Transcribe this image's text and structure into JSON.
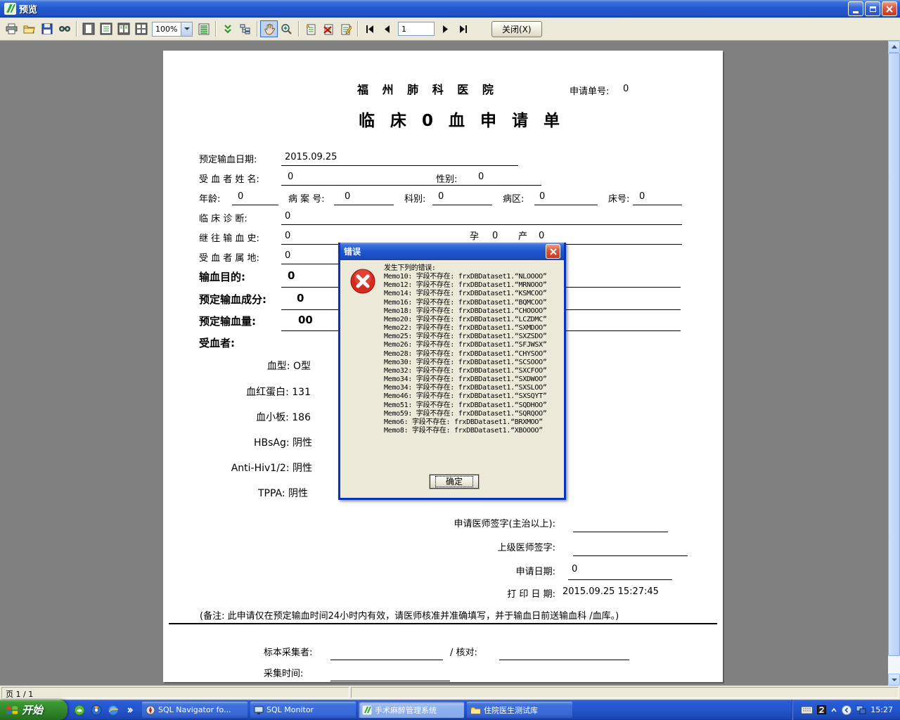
{
  "window": {
    "title": "预览"
  },
  "toolbar": {
    "zoom_level": "100%",
    "page_number": "1",
    "close_label": "关闭(X)"
  },
  "statusbar": {
    "page_info": "页 1 / 1"
  },
  "form": {
    "hospital": "福 州 肺 科 医 院",
    "app_no_label": "申请单号:",
    "app_no_value": "0",
    "title": "临 床 0  血 申 请 单",
    "rows": {
      "date_label": "预定输血日期:",
      "date_value": "2015.09.25",
      "name_label": "受 血 者 姓 名:",
      "name_value": "0",
      "sex_label": "性别:",
      "sex_value": "0",
      "age_label": "年龄:",
      "age_value": "0",
      "case_label": "病 案 号:",
      "case_value": "0",
      "dept_label": "科别:",
      "dept_value": "0",
      "ward_label": "病区:",
      "ward_value": "0",
      "bed_label": "床号:",
      "bed_value": "0",
      "diag_label": "临 床 诊 断:",
      "diag_value": "0",
      "history_label": "继 往 输 血 史:",
      "history_value": "0",
      "preg_label": "孕",
      "preg_value": "0",
      "birth_label": "产",
      "birth_value": "0",
      "domicile_label": "受 血 者 属 地:",
      "domicile_value": "0",
      "purpose_label": "输血目的:",
      "purpose_value": "0",
      "component_label": "预定输血成分:",
      "component_value": "0",
      "volume_label": "预定输血量:",
      "volume_value": "00",
      "recipient_label": "受血者:"
    },
    "labs": [
      "血型: O型",
      "血红蛋白: 131",
      "血小板: 186",
      "HBsAg: 阴性",
      "Anti-Hiv1/2: 阴性",
      "TPPA: 阴性"
    ],
    "signatures": {
      "physician_label": "申请医师签字(主治以上):",
      "senior_label": "上级医师签字:",
      "apply_date_label": "申请日期:",
      "apply_date_value": "0",
      "print_date_label": "打 印 日 期:",
      "print_date_value": "2015.09.25 15:27:45"
    },
    "note": "(备注: 此申请仅在预定输血时间24小时内有效，请医师核准并准确填写，并于输血日前送输血科 /血库。)",
    "footer": {
      "collector_label": "标本采集者:",
      "check_label": "/ 核对:",
      "collect_time_label": "采集时间:"
    }
  },
  "dialog": {
    "title": "错误",
    "header": "发生下列的错误:",
    "errors": [
      "Memo10: 字段不存在: frxDBDataset1.“NLOOOO”",
      "Memo12: 字段不存在: frxDBDataset1.“MRNOOO”",
      "Memo14: 字段不存在: frxDBDataset1.“KSMCOO”",
      "Memo16: 字段不存在: frxDBDataset1.“BQMCOO”",
      "Memo18: 字段不存在: frxDBDataset1.“CHOOOO”",
      "Memo20: 字段不存在: frxDBDataset1.“LCZDMC”",
      "Memo22: 字段不存在: frxDBDataset1.“SXMDOO”",
      "Memo25: 字段不存在: frxDBDataset1.“SXZSDO”",
      "Memo26: 字段不存在: frxDBDataset1.“SFJWSX”",
      "Memo28: 字段不存在: frxDBDataset1.“CHYSOO”",
      "Memo30: 字段不存在: frxDBDataset1.“SCSOOO”",
      "Memo32: 字段不存在: frxDBDataset1.“SXCFOO”",
      "Memo34: 字段不存在: frxDBDataset1.“SXDWOO”",
      "Memo34: 字段不存在: frxDBDataset1.“SXSLOO”",
      "Memo46: 字段不存在: frxDBDataset1.“SXSQYT”",
      "Memo51: 字段不存在: frxDBDataset1.“SQDHOO”",
      "Memo59: 字段不存在: frxDBDataset1.“SQRQOO”",
      "Memo6: 字段不存在: frxDBDataset1.“BRXMOO”",
      "Memo8: 字段不存在: frxDBDataset1.“XBOOOO”"
    ],
    "ok_label": "确定"
  },
  "taskbar": {
    "start_label": "开始",
    "tasks": [
      {
        "label": "SQL Navigator fo..."
      },
      {
        "label": "SQL Monitor"
      },
      {
        "label": "手术麻醉管理系统"
      },
      {
        "label": "住院医生测试库"
      }
    ],
    "clock": "15:27"
  }
}
